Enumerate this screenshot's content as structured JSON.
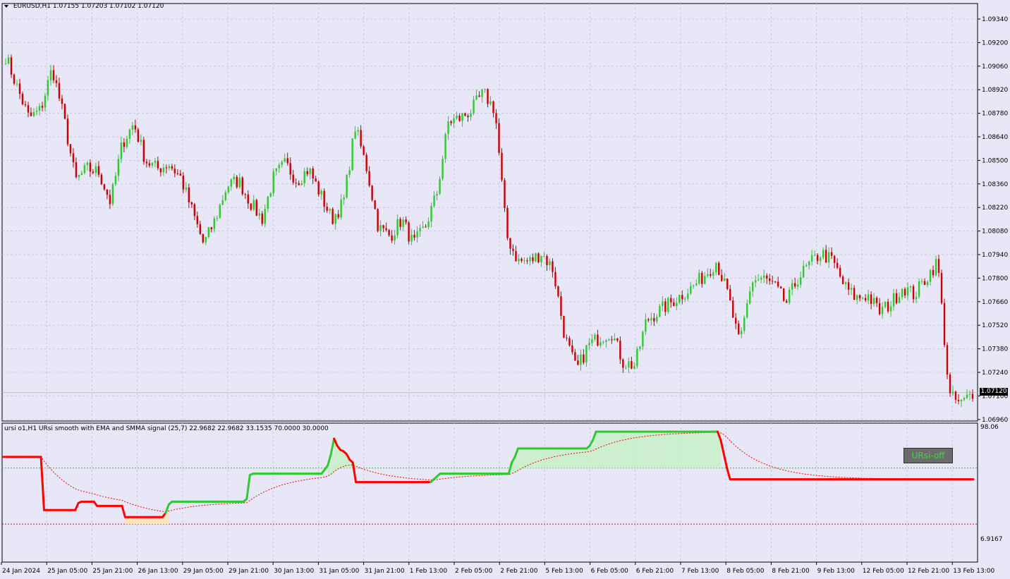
{
  "header": {
    "symbol": "EURUSD,H1",
    "ohlc": "1.07155 1.07203 1.07102 1.07120"
  },
  "indicator": {
    "title": "ursi o1,H1 URsi smooth with EMA and SMMA signal (25,7) 22.9682 22.9682 33.1535 70.0000 30.0000",
    "badge": "URsi-off",
    "scale_top": "98.06",
    "scale_bottom": "6.9167"
  },
  "current_price": "1.07120",
  "price_axis": [
    "1.09340",
    "1.09200",
    "1.09060",
    "1.08920",
    "1.08780",
    "1.08640",
    "1.08500",
    "1.08360",
    "1.08220",
    "1.08080",
    "1.07940",
    "1.07800",
    "1.07660",
    "1.07520",
    "1.07380",
    "1.07240",
    "1.07100",
    "1.06960"
  ],
  "time_axis": [
    "24 Jan 2024",
    "25 Jan 05:00",
    "25 Jan 21:00",
    "26 Jan 13:00",
    "29 Jan 05:00",
    "29 Jan 21:00",
    "30 Jan 13:00",
    "31 Jan 05:00",
    "31 Jan 21:00",
    "1 Feb 13:00",
    "2 Feb 05:00",
    "2 Feb 21:00",
    "5 Feb 13:00",
    "6 Feb 05:00",
    "6 Feb 21:00",
    "7 Feb 13:00",
    "8 Feb 05:00",
    "8 Feb 21:00",
    "9 Feb 13:00",
    "12 Feb 05:00",
    "12 Feb 21:00",
    "13 Feb 13:00"
  ],
  "colors": {
    "background": "#e7e7f7",
    "grid": "#c8c8dc",
    "bull": "#32c832",
    "bear": "#c80000",
    "rsi_up": "#32c832",
    "rsi_down": "#ff0000",
    "fill_up": "#c8f0c8",
    "fill_down": "#ffe4b4"
  },
  "chart_data": {
    "type": "candlestick",
    "ylim": [
      1.0696,
      1.0947
    ],
    "anchor_closes": [
      1.0912,
      1.0893,
      1.0875,
      1.088,
      1.0905,
      1.0875,
      1.0838,
      1.0845,
      1.0843,
      1.0825,
      1.086,
      1.0872,
      1.085,
      1.0845,
      1.0848,
      1.084,
      1.082,
      1.08,
      1.0815,
      1.0835,
      1.0838,
      1.0825,
      1.0815,
      1.084,
      1.0848,
      1.0838,
      1.0845,
      1.083,
      1.0815,
      1.0825,
      1.087,
      1.0845,
      1.081,
      1.0805,
      1.0815,
      1.08,
      1.081,
      1.083,
      1.0873,
      1.0875,
      1.088,
      1.089,
      1.088,
      1.0805,
      1.079,
      1.079,
      1.0795,
      1.0785,
      1.0745,
      1.0725,
      1.074,
      1.0745,
      1.0748,
      1.073,
      1.0728,
      1.0755,
      1.076,
      1.0765,
      1.077,
      1.0775,
      1.0782,
      1.079,
      1.077,
      1.074,
      1.0778,
      1.078,
      1.0775,
      1.0765,
      1.078,
      1.0788,
      1.0795,
      1.079,
      1.0775,
      1.0768,
      1.077,
      1.076,
      1.0765,
      1.0775,
      1.077,
      1.078,
      1.079,
      1.071,
      1.0705,
      1.0712
    ],
    "indicator": {
      "series": [
        {
          "name": "URsi",
          "levels": [
            78,
            78,
            78,
            78,
            78,
            78,
            78,
            78,
            78,
            78,
            78,
            78,
            78,
            40,
            40,
            40,
            40,
            40,
            40,
            40,
            40,
            40,
            40,
            40,
            45,
            46,
            46,
            46,
            46,
            46,
            43,
            43,
            43,
            43,
            43,
            43,
            43,
            43,
            43,
            35,
            35,
            35,
            35,
            35,
            35,
            35,
            35,
            35,
            35,
            35,
            35,
            35,
            38,
            44,
            46,
            46,
            46,
            46,
            46,
            46,
            46,
            46,
            46,
            46,
            46,
            46,
            46,
            46,
            46,
            46,
            46,
            46,
            46,
            46,
            46,
            46,
            46,
            46,
            48,
            65,
            66,
            66,
            66,
            66,
            66,
            66,
            66,
            66,
            66,
            66,
            66,
            66,
            66,
            66,
            66,
            66,
            66,
            66,
            66,
            66,
            66,
            66,
            66,
            69,
            72,
            80,
            91,
            86,
            83,
            82,
            80,
            76,
            74,
            60,
            60,
            60,
            60,
            60,
            60,
            60,
            60,
            60,
            60,
            60,
            60,
            60,
            60,
            60,
            60,
            60,
            60,
            60,
            60,
            60,
            60,
            60,
            60,
            60,
            62,
            64,
            66,
            66,
            66,
            66,
            66,
            66,
            66,
            66,
            66,
            66,
            66,
            66,
            66,
            66,
            66,
            66,
            66,
            66,
            66,
            66,
            66,
            66,
            66,
            74,
            78,
            84,
            84,
            84,
            84,
            84,
            84,
            84,
            84,
            84,
            84,
            84,
            84,
            84,
            84,
            84,
            84,
            84,
            84,
            84,
            84,
            84,
            84,
            84,
            86,
            90,
            96,
            96,
            96,
            96,
            96,
            96,
            96,
            96,
            96,
            96,
            96,
            96,
            96,
            96,
            96,
            96,
            96,
            96,
            96,
            96,
            96,
            96,
            96,
            96,
            96,
            96,
            96,
            96,
            96,
            96,
            96,
            96,
            96,
            96,
            96,
            96,
            96,
            96,
            96,
            96,
            90,
            80,
            70,
            62,
            62,
            62,
            62,
            62,
            62,
            62,
            62,
            62,
            62,
            62,
            62,
            62,
            62,
            62,
            62,
            62,
            62,
            62,
            62,
            62,
            62,
            62,
            62,
            62,
            62,
            62,
            62,
            62,
            62,
            62,
            62,
            62,
            62,
            62,
            62,
            62,
            62,
            62,
            62,
            62,
            62,
            62,
            62,
            62,
            62,
            62,
            62,
            62,
            62,
            62,
            62,
            62,
            62,
            62,
            62,
            62,
            62,
            62,
            62,
            62,
            62,
            62,
            62,
            62,
            62,
            62,
            62,
            62,
            62,
            62,
            62,
            62,
            62,
            62,
            62,
            62,
            62,
            62
          ]
        }
      ],
      "levels": [
        70,
        30
      ],
      "ylim": [
        6.9167,
        98.06
      ]
    }
  }
}
